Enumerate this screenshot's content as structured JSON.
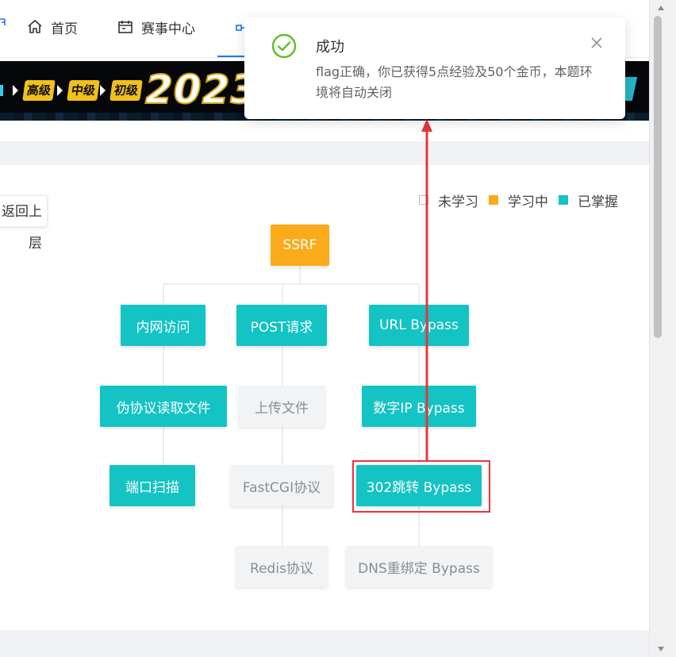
{
  "nav": {
    "items": [
      {
        "label": "首页",
        "icon": "home-icon"
      },
      {
        "label": "赛事中心",
        "icon": "calendar-icon"
      }
    ],
    "active_icon": "tree-icon"
  },
  "banner": {
    "tags": [
      "高级",
      "中级",
      "初级"
    ],
    "headline": "2023护网"
  },
  "back_button": {
    "label": "返回上层"
  },
  "legend": {
    "items": [
      {
        "label": "未学习",
        "color": "#ffffff"
      },
      {
        "label": "学习中",
        "color": "#fbab19"
      },
      {
        "label": "已掌握",
        "color": "#14c3c4"
      }
    ]
  },
  "tree": {
    "root": {
      "label": "SSRF",
      "status": "learning"
    },
    "nodes": [
      {
        "label": "内网访问",
        "status": "mastered"
      },
      {
        "label": "POST请求",
        "status": "mastered"
      },
      {
        "label": "URL Bypass",
        "status": "mastered"
      },
      {
        "label": "伪协议读取文件",
        "status": "mastered"
      },
      {
        "label": "上传文件",
        "status": "unlearned"
      },
      {
        "label": "数字IP Bypass",
        "status": "mastered"
      },
      {
        "label": "端口扫描",
        "status": "mastered"
      },
      {
        "label": "FastCGI协议",
        "status": "unlearned"
      },
      {
        "label": "302跳转 Bypass",
        "status": "mastered"
      },
      {
        "label": "Redis协议",
        "status": "unlearned"
      },
      {
        "label": "DNS重绑定 Bypass",
        "status": "unlearned"
      }
    ]
  },
  "notification": {
    "title": "成功",
    "message": "flag正确，你已获得5点经验及50个金币，本题环境将自动关闭",
    "icon": "success-check-icon",
    "close_icon": "close-icon"
  },
  "colors": {
    "mastered": "#14c3c4",
    "learning": "#fbab19",
    "unlearned": "#f2f3f5",
    "annotation": "#e8343a",
    "accent": "#1a78f0"
  }
}
